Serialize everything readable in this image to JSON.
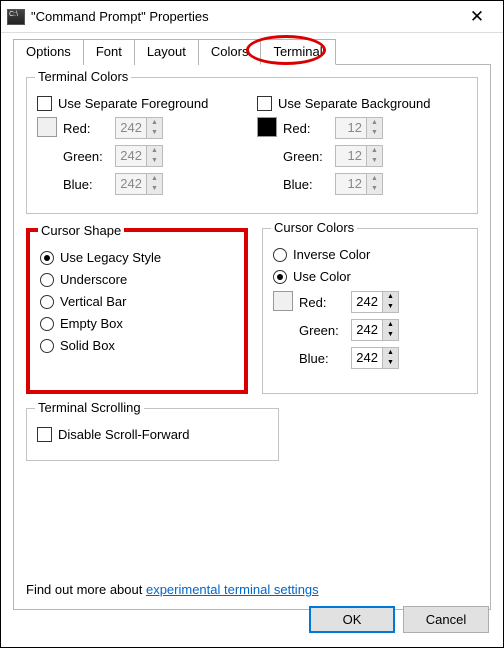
{
  "titlebar": {
    "title": "\"Command Prompt\" Properties"
  },
  "tabs": {
    "options": "Options",
    "font": "Font",
    "layout": "Layout",
    "colors": "Colors",
    "terminal": "Terminal"
  },
  "terminal_colors": {
    "legend": "Terminal Colors",
    "fg_check": "Use Separate Foreground",
    "bg_check": "Use Separate Background",
    "red_label": "Red:",
    "green_label": "Green:",
    "blue_label": "Blue:",
    "fg": {
      "red": "242",
      "green": "242",
      "blue": "242"
    },
    "bg": {
      "red": "12",
      "green": "12",
      "blue": "12"
    }
  },
  "cursor_shape": {
    "legend": "Cursor Shape",
    "options": {
      "legacy": "Use Legacy Style",
      "underscore": "Underscore",
      "vertical": "Vertical Bar",
      "empty": "Empty Box",
      "solid": "Solid Box"
    }
  },
  "cursor_colors": {
    "legend": "Cursor Colors",
    "inverse": "Inverse Color",
    "use_color": "Use Color",
    "red_label": "Red:",
    "green_label": "Green:",
    "blue_label": "Blue:",
    "rgb": {
      "red": "242",
      "green": "242",
      "blue": "242"
    }
  },
  "scrolling": {
    "legend": "Terminal Scrolling",
    "disable": "Disable Scroll-Forward"
  },
  "footer": {
    "prefix": "Find out more about ",
    "link": "experimental terminal settings"
  },
  "buttons": {
    "ok": "OK",
    "cancel": "Cancel"
  }
}
